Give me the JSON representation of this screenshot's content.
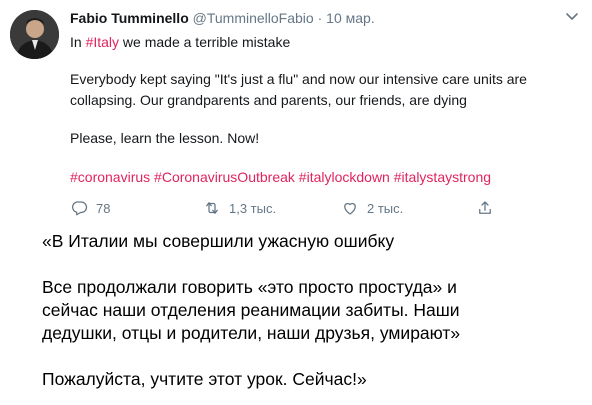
{
  "tweet": {
    "author_name": "Fabio Tumminello",
    "author_handle": "@TumminelloFabio",
    "separator": "·",
    "date": "10 мар.",
    "line1_pre": "In ",
    "line1_tag": "#Italy",
    "line1_post": " we made a terrible mistake",
    "line2": "Everybody kept saying \"It's just a flu\" and now our intensive care units are",
    "line3": "collapsing. Our grandparents and parents, our friends, are dying",
    "line4": "Please, learn the lesson. Now!",
    "hashtags": [
      "#coronavirus",
      "#CoronavirusOutbreak",
      "#italylockdown",
      "#italystaystrong"
    ],
    "actions": {
      "reply_count": "78",
      "retweet_count": "1,3 тыс.",
      "like_count": "2 тыс."
    },
    "accent_color": "#e0245e",
    "muted_color": "#657786"
  },
  "translation": {
    "line1": "«В Италии мы совершили ужасную ошибку",
    "line2": "Все продолжали говорить «это просто простуда» и",
    "line3": "сейчас наши отделения реанимации забиты. Наши",
    "line4": "дедушки, отцы и родители, наши друзья, умирают»",
    "line5": "Пожалуйста, учтите этот урок. Сейчас!»"
  }
}
